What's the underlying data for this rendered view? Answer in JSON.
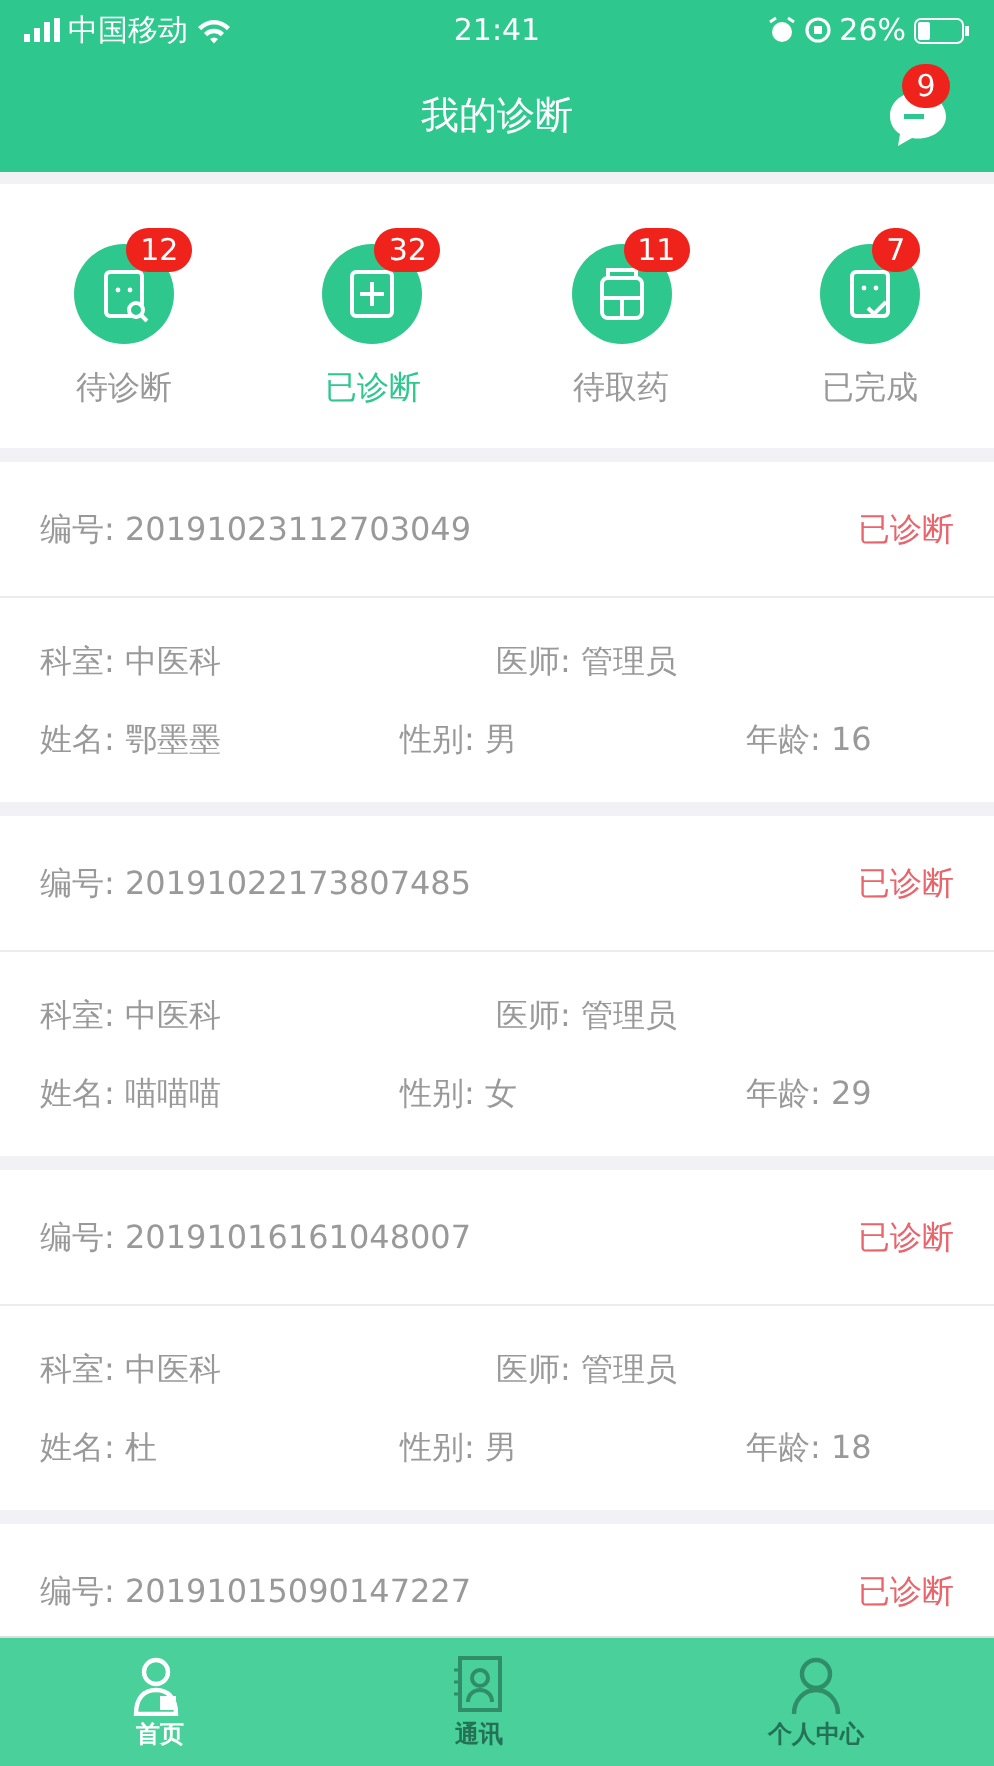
{
  "status_bar": {
    "carrier": "中国移动",
    "time": "21:41",
    "battery": "26%"
  },
  "header": {
    "title": "我的诊断",
    "message_count": "9"
  },
  "categories": [
    {
      "label": "待诊断",
      "count": "12",
      "selected": false,
      "kind": "search"
    },
    {
      "label": "已诊断",
      "count": "32",
      "selected": true,
      "kind": "plus"
    },
    {
      "label": "待取药",
      "count": "11",
      "selected": false,
      "kind": "bag"
    },
    {
      "label": "已完成",
      "count": "7",
      "selected": false,
      "kind": "check"
    }
  ],
  "records": [
    {
      "number": "编号: 20191023112703049",
      "status": "已诊断",
      "department": "科室: 中医科",
      "doctor": "医师: 管理员",
      "name": "姓名: 鄂墨墨",
      "gender": "性别: 男",
      "age": "年龄: 16"
    },
    {
      "number": "编号: 20191022173807485",
      "status": "已诊断",
      "department": "科室: 中医科",
      "doctor": "医师: 管理员",
      "name": "姓名: 喵喵喵",
      "gender": "性别: 女",
      "age": "年龄: 29"
    },
    {
      "number": "编号: 20191016161048007",
      "status": "已诊断",
      "department": "科室: 中医科",
      "doctor": "医师: 管理员",
      "name": "姓名: 杜",
      "gender": "性别: 男",
      "age": "年龄: 18"
    },
    {
      "number": "编号: 20191015090147227",
      "status": "已诊断"
    }
  ],
  "tab_bar": [
    {
      "label": "首页",
      "selected": true,
      "kind": "doctor"
    },
    {
      "label": "通讯",
      "selected": false,
      "kind": "contacts"
    },
    {
      "label": "个人中心",
      "selected": false,
      "kind": "person"
    }
  ]
}
